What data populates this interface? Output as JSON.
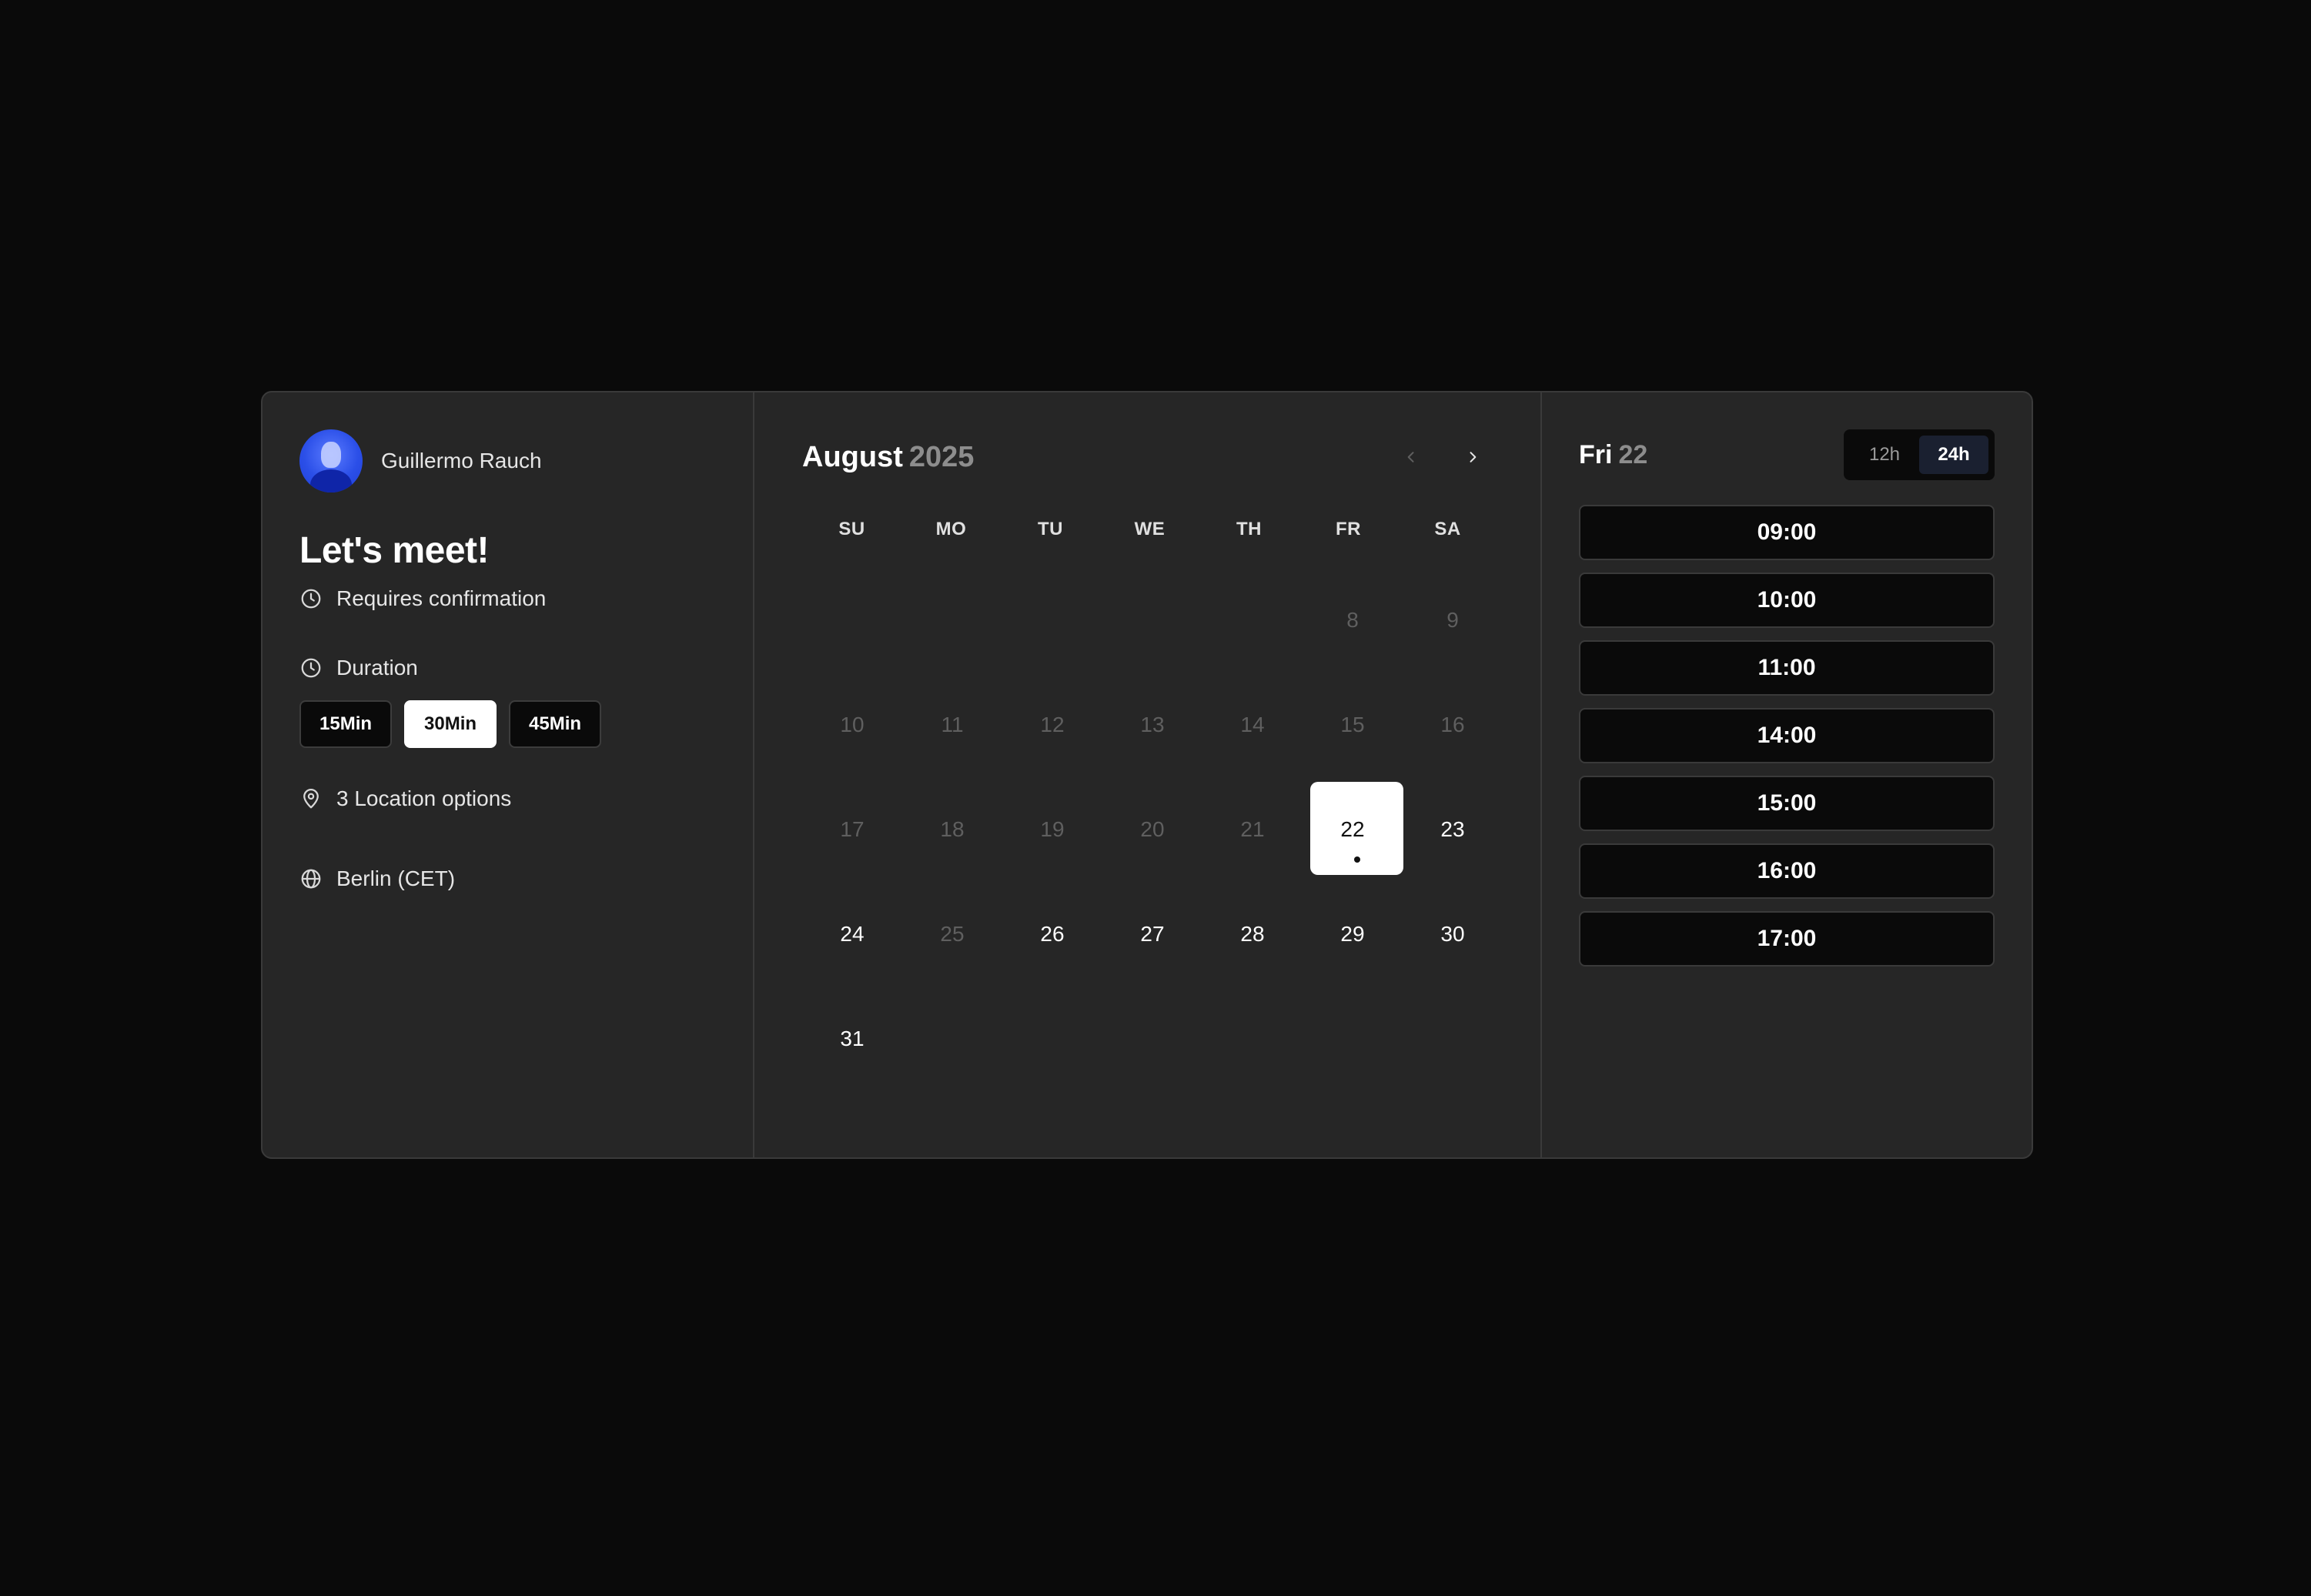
{
  "host": {
    "name": "Guillermo Rauch"
  },
  "event": {
    "title": "Let's meet!",
    "confirmation": "Requires confirmation",
    "duration_label": "Duration",
    "durations": [
      "15Min",
      "30Min",
      "45Min"
    ],
    "selected_duration": "30Min",
    "location": "3 Location options",
    "timezone": "Berlin (CET)"
  },
  "calendar": {
    "month": "August",
    "year": "2025",
    "weekdays": [
      "SU",
      "MO",
      "TU",
      "WE",
      "TH",
      "FR",
      "SA"
    ],
    "leading_blanks": 5,
    "days": [
      {
        "d": "8",
        "available": false
      },
      {
        "d": "9",
        "available": false
      },
      {
        "d": "10",
        "available": false
      },
      {
        "d": "11",
        "available": false
      },
      {
        "d": "12",
        "available": false
      },
      {
        "d": "13",
        "available": false
      },
      {
        "d": "14",
        "available": false
      },
      {
        "d": "15",
        "available": false
      },
      {
        "d": "16",
        "available": false
      },
      {
        "d": "17",
        "available": false
      },
      {
        "d": "18",
        "available": false
      },
      {
        "d": "19",
        "available": false
      },
      {
        "d": "20",
        "available": false
      },
      {
        "d": "21",
        "available": false
      },
      {
        "d": "22",
        "available": true,
        "selected": true
      },
      {
        "d": "23",
        "available": true
      },
      {
        "d": "24",
        "available": true
      },
      {
        "d": "25",
        "available": false
      },
      {
        "d": "26",
        "available": true
      },
      {
        "d": "27",
        "available": true
      },
      {
        "d": "28",
        "available": true
      },
      {
        "d": "29",
        "available": true
      },
      {
        "d": "30",
        "available": true
      },
      {
        "d": "31",
        "available": true
      }
    ]
  },
  "times": {
    "day_label": "Fri",
    "day_num": "22",
    "formats": [
      "12h",
      "24h"
    ],
    "selected_format": "24h",
    "slots": [
      "09:00",
      "10:00",
      "11:00",
      "14:00",
      "15:00",
      "16:00",
      "17:00"
    ]
  },
  "colors": {
    "background": "#0a0a0a",
    "card": "#262626",
    "avatar": "#2b4fe8"
  }
}
